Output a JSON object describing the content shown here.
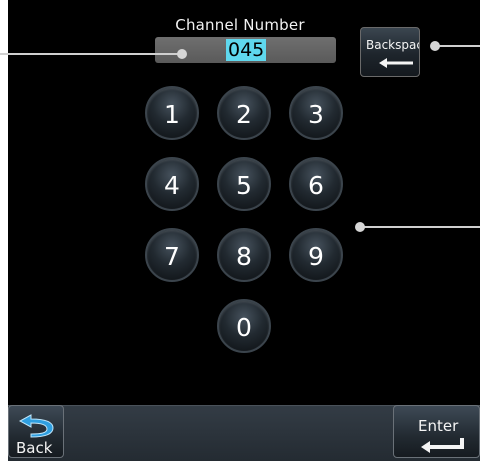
{
  "header": {
    "title": "Channel Number"
  },
  "field": {
    "value": "045"
  },
  "backspace": {
    "label": "Backspac"
  },
  "keypad": {
    "keys": [
      "1",
      "2",
      "3",
      "4",
      "5",
      "6",
      "7",
      "8",
      "9",
      "0"
    ]
  },
  "softkeys": {
    "back_label": "Back",
    "enter_label": "Enter"
  },
  "colors": {
    "accent": "#5fd8ee",
    "background": "#000000",
    "bar": "#2b333a"
  }
}
